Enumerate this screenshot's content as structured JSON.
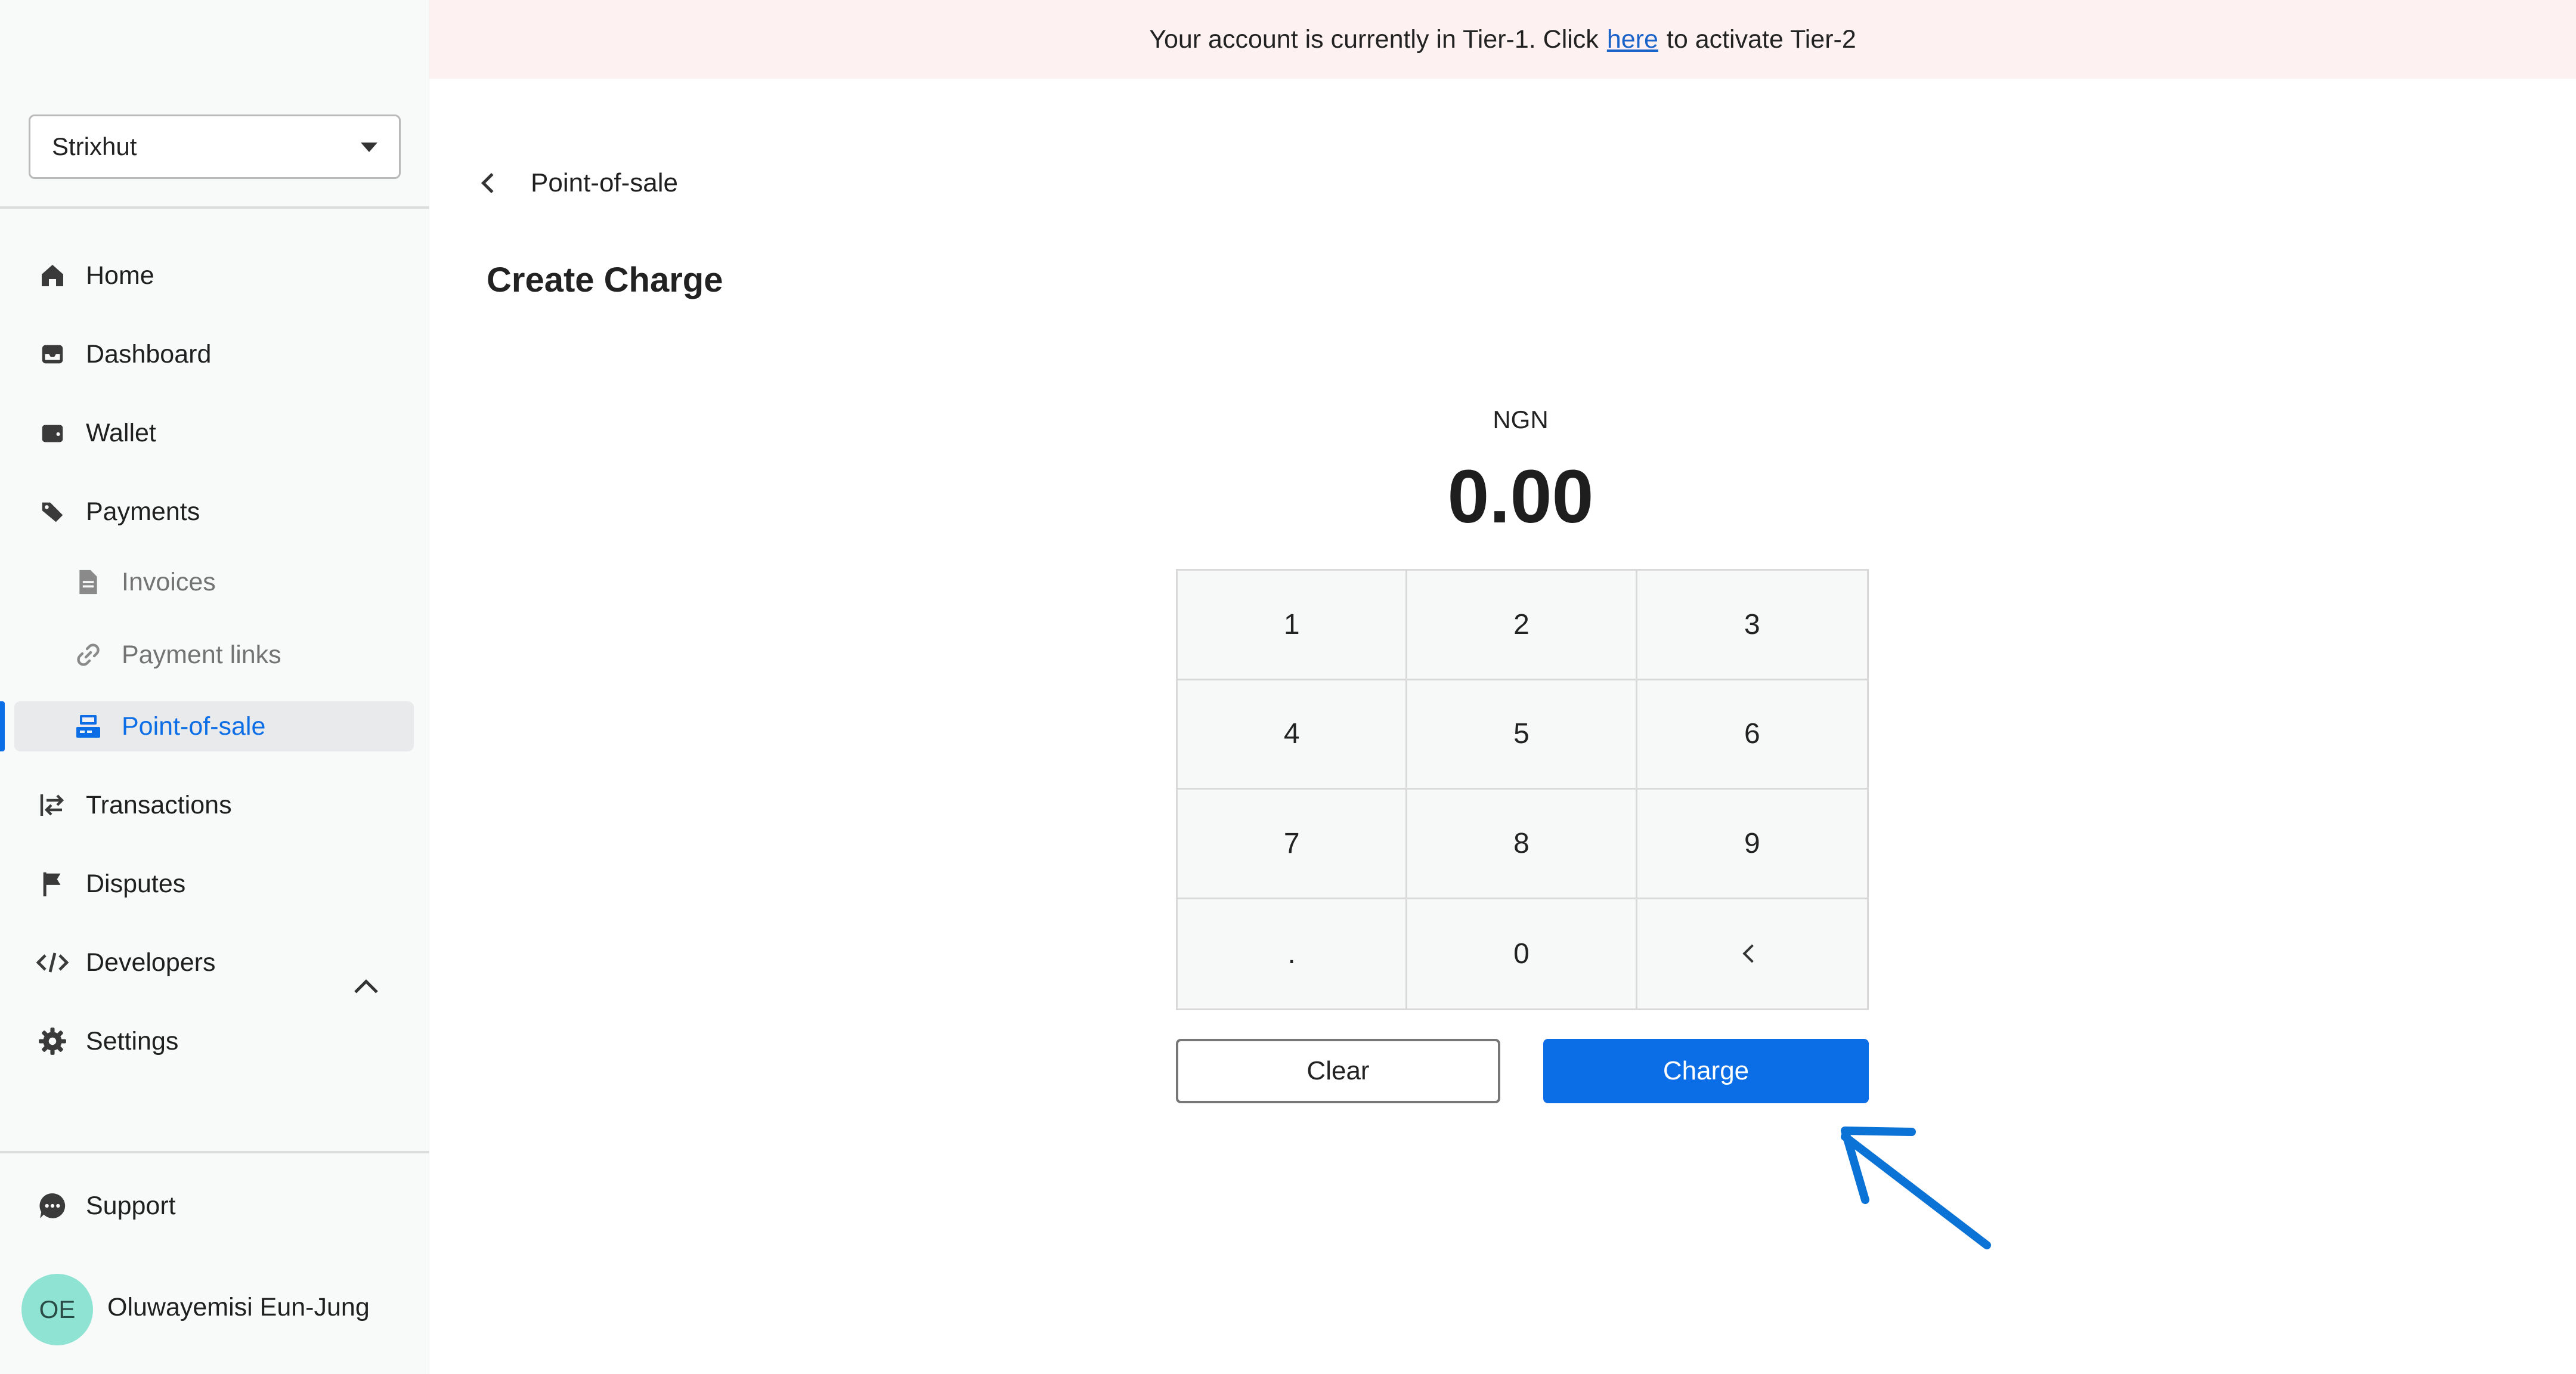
{
  "banner": {
    "text_before": "Your account is currently in Tier-1. Click",
    "link_text": "here",
    "text_after": "to activate Tier-2"
  },
  "sidebar": {
    "org_select": "Strixhut",
    "nav": {
      "home": "Home",
      "dashboard": "Dashboard",
      "wallet": "Wallet",
      "payments": "Payments",
      "invoices": "Invoices",
      "payment_links": "Payment links",
      "point_of_sale": "Point-of-sale",
      "transactions": "Transactions",
      "disputes": "Disputes",
      "developers": "Developers",
      "settings": "Settings",
      "support": "Support"
    },
    "user": {
      "initials": "OE",
      "name": "Oluwayemisi Eun-Jung"
    }
  },
  "main": {
    "breadcrumb": "Point-of-sale",
    "title": "Create Charge",
    "currency": "NGN",
    "amount": "0.00",
    "keypad": [
      "1",
      "2",
      "3",
      "4",
      "5",
      "6",
      "7",
      "8",
      "9",
      ".",
      "0"
    ],
    "clear_label": "Clear",
    "charge_label": "Charge"
  },
  "colors": {
    "accent": "#0b6ee6",
    "banner_bg": "#fdf2f1",
    "sidebar_bg": "#f8f9f9",
    "avatar_bg": "#8fe3d3"
  },
  "icons": [
    "home-icon",
    "inbox-icon",
    "wallet-icon",
    "tag-icon",
    "document-icon",
    "link-icon",
    "register-icon",
    "transfer-icon",
    "flag-icon",
    "code-icon",
    "gear-icon",
    "chat-icon",
    "chevron-up-icon",
    "chevron-left-icon",
    "caret-down-icon"
  ]
}
